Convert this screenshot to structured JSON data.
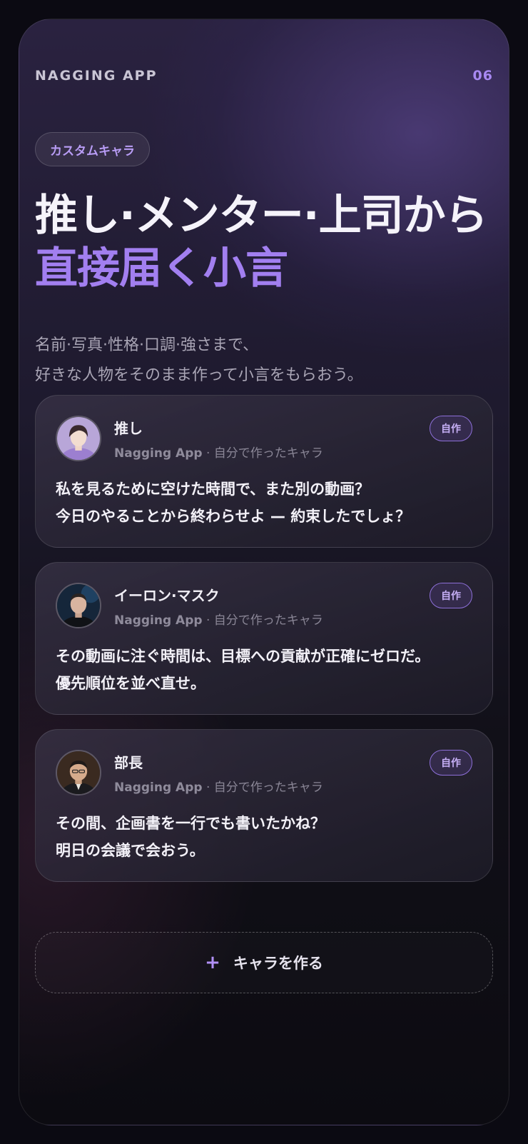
{
  "header": {
    "app_name": "NAGGING APP",
    "page_number": "06"
  },
  "tag": "カスタムキャラ",
  "headline": {
    "line1": "推し·メンター·上司から",
    "line2": "直接届く小言"
  },
  "subtitle": {
    "line1": "名前·写真·性格·口調·強さまで、",
    "line2": "好きな人物をそのまま作って小言をもらおう。"
  },
  "cards": [
    {
      "name": "推し",
      "app": "Nagging App",
      "source": "· 自分で作ったキャラ",
      "badge": "自作",
      "avatar": "idol-avatar",
      "quote_line1": "私を見るために空けた時間で、また別の動画？",
      "quote_line2": "今日のやることから終わらせよ — 約束したでしょ？"
    },
    {
      "name": "イーロン·マスク",
      "app": "Nagging App",
      "source": "· 自分で作ったキャラ",
      "badge": "自作",
      "avatar": "entrepreneur-avatar",
      "quote_line1": "その動画に注ぐ時間は、目標への貢献が正確にゼロだ。",
      "quote_line2": "優先順位を並べ直せ。"
    },
    {
      "name": "部長",
      "app": "Nagging App",
      "source": "· 自分で作ったキャラ",
      "badge": "自作",
      "avatar": "manager-avatar",
      "quote_line1": "その間、企画書を一行でも書いたかね？",
      "quote_line2": "明日の会議で会おう。"
    }
  ],
  "create_button": {
    "icon": "plus-icon",
    "label": "キャラを作る"
  },
  "colors": {
    "accent": "#a27ff0",
    "badge_border": "#8d6fd8",
    "background": "#0b0a12"
  }
}
